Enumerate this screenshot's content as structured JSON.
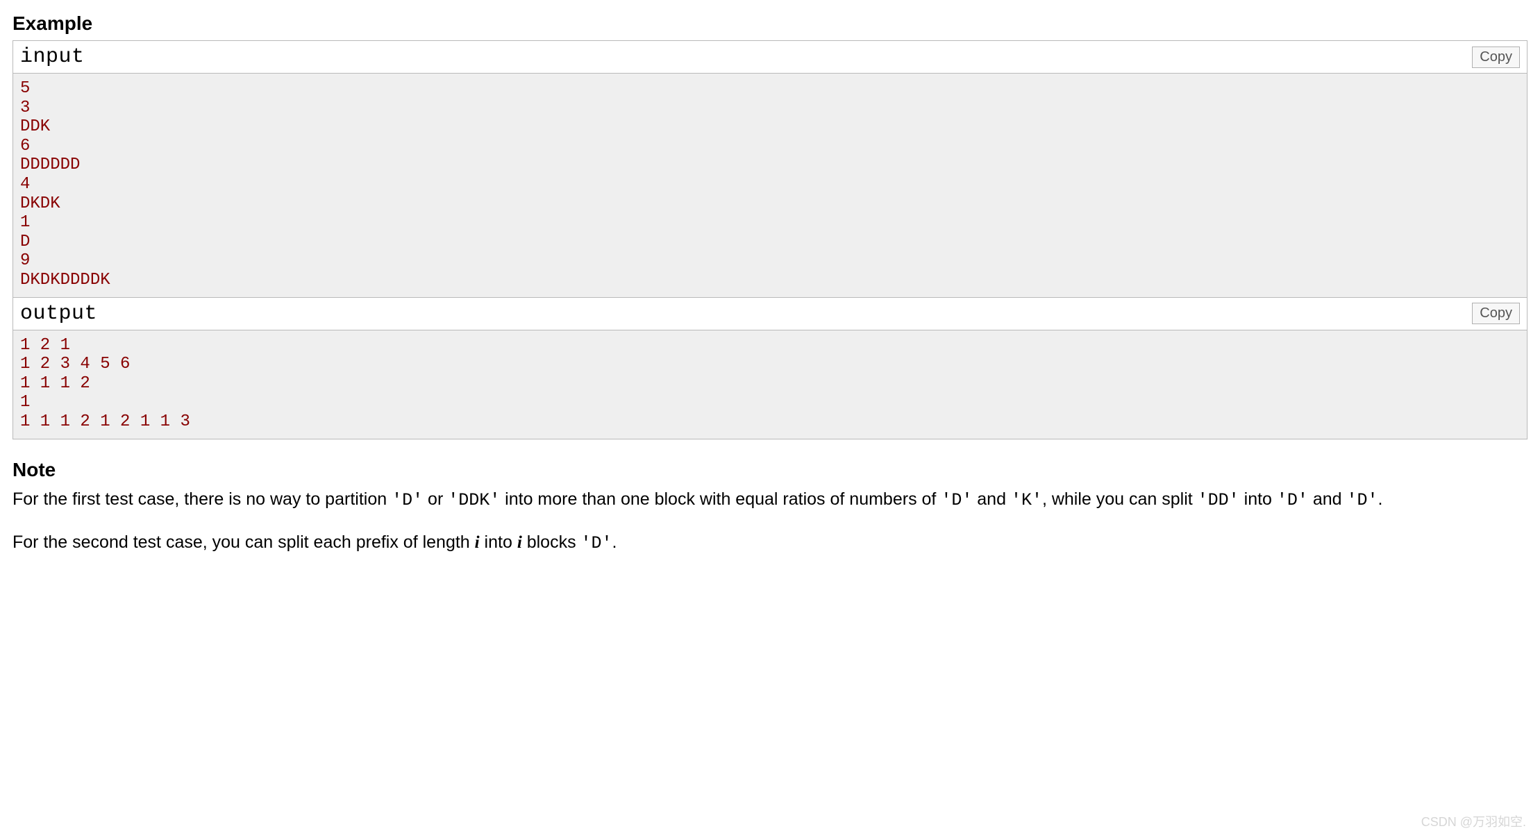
{
  "example": {
    "heading": "Example",
    "input": {
      "label": "input",
      "copy": "Copy",
      "content": "5\n3\nDDK\n6\nDDDDDD\n4\nDKDK\n1\nD\n9\nDKDKDDDDK"
    },
    "output": {
      "label": "output",
      "copy": "Copy",
      "content": "1 2 1\n1 2 3 4 5 6\n1 1 1 2\n1\n1 1 1 2 1 2 1 1 3"
    }
  },
  "note": {
    "heading": "Note",
    "p1": {
      "t1": "For the first test case, there is no way to partition ",
      "c1": "'D'",
      "t2": " or ",
      "c2": "'DDK'",
      "t3": " into more than one block with equal ratios of numbers of ",
      "c3": "'D'",
      "t4": " and ",
      "c4": "'K'",
      "t5": ", while you can split ",
      "c5": "'DD'",
      "t6": " into ",
      "c6": "'D'",
      "t7": " and ",
      "c7": "'D'",
      "t8": "."
    },
    "p2": {
      "t1": "For the second test case, you can split each prefix of length ",
      "i1": "i",
      "t2": " into ",
      "i2": "i",
      "t3": " blocks ",
      "c1": "'D'",
      "t4": "."
    }
  },
  "watermark": "CSDN @万羽如空."
}
